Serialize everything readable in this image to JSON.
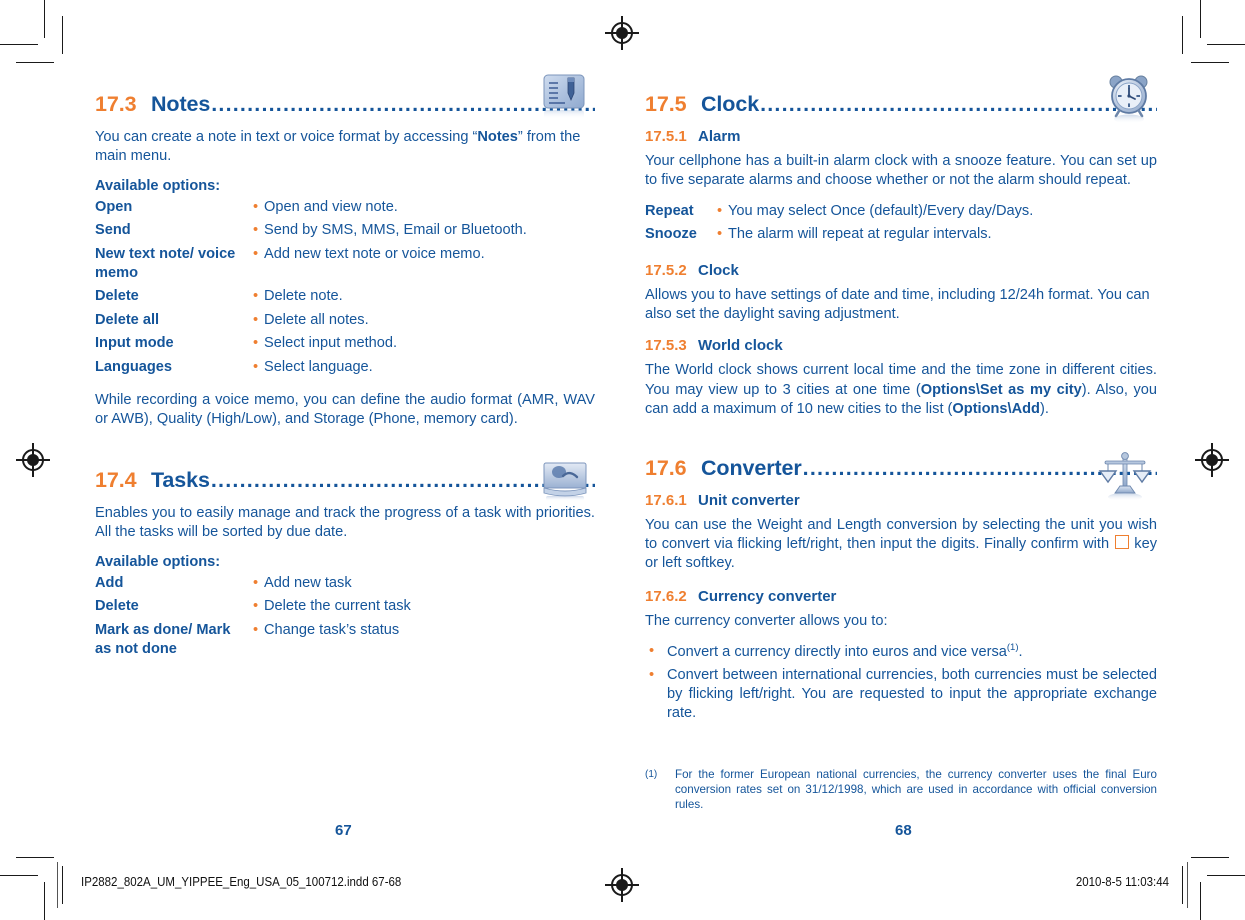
{
  "document": {
    "left_page_number": "67",
    "right_page_number": "68",
    "colors": {
      "heading_number": "#ef7f30",
      "heading_title": "#15559a",
      "body": "#15559a",
      "bullet": "#ef7f30"
    }
  },
  "left_column": {
    "section_notes": {
      "number": "17.3",
      "title": "Notes",
      "dots": "............................................................",
      "icon": "notepad-pen-icon",
      "intro_before_bold": "You can create a note in text or voice format by accessing “",
      "intro_bold": "Notes",
      "intro_after_bold": "” from the main menu.",
      "available_options_label": "Available options:",
      "options": [
        {
          "key": "Open",
          "value": "Open and view note."
        },
        {
          "key": "Send",
          "value": "Send by SMS, MMS, Email or Bluetooth."
        },
        {
          "key": "New text note/ voice memo",
          "value": "Add new text note or voice memo."
        },
        {
          "key": "Delete",
          "value": "Delete note."
        },
        {
          "key": "Delete all",
          "value": "Delete all notes."
        },
        {
          "key": "Input mode",
          "value": "Select input method."
        },
        {
          "key": "Languages",
          "value": "Select language."
        }
      ],
      "closing_paragraph": "While recording a voice memo, you can define the audio format (AMR, WAV or AWB), Quality (High/Low), and Storage (Phone, memory card)."
    },
    "section_tasks": {
      "number": "17.4",
      "title": "Tasks",
      "dots": "............................................................",
      "icon": "tasks-scroll-icon",
      "intro": "Enables you to easily manage and track the progress of a task with priorities. All the tasks will be sorted by due date.",
      "available_options_label": "Available options:",
      "options": [
        {
          "key": "Add",
          "value": "Add new task"
        },
        {
          "key": "Delete",
          "value": "Delete the current task"
        },
        {
          "key": "Mark as done/ Mark as not done",
          "value": "Change task’s status"
        }
      ]
    }
  },
  "right_column": {
    "section_clock": {
      "number": "17.5",
      "title": "Clock",
      "dots": "..............................................................",
      "icon": "alarm-clock-icon",
      "sub_alarm": {
        "number": "17.5.1",
        "title": "Alarm",
        "paragraph": "Your cellphone has a built-in alarm clock with a snooze feature. You can set up to five separate alarms and choose whether or not the alarm should repeat.",
        "options": [
          {
            "key": "Repeat",
            "value": "You may select Once (default)/Every day/Days."
          },
          {
            "key": "Snooze",
            "value": "The alarm will repeat at regular intervals."
          }
        ]
      },
      "sub_clock": {
        "number": "17.5.2",
        "title": "Clock",
        "paragraph": "Allows you to have settings of date and time, including 12/24h format. You can also set the daylight saving adjustment."
      },
      "sub_world_clock": {
        "number": "17.5.3",
        "title": "World clock",
        "para_a": "The World clock shows current local time and the time zone in different cities. You may view up to 3 cities at one time (",
        "para_bold_a": "Options\\Set as my city",
        "para_b": "). Also, you can add a maximum of 10 new cities to the list (",
        "para_bold_b": "Options\\Add",
        "para_c": ")."
      }
    },
    "section_converter": {
      "number": "17.6",
      "title": "Converter",
      "dots": "....................................................",
      "icon": "balance-scale-icon",
      "sub_unit": {
        "number": "17.6.1",
        "title": "Unit converter",
        "para_a": "You can use the Weight and Length conversion by selecting the unit you wish to convert via flicking left/right, then input the digits. Finally confirm with",
        "key_glyph": "softkey-box-icon",
        "para_b": "key or left softkey."
      },
      "sub_currency": {
        "number": "17.6.2",
        "title": "Currency converter",
        "intro": "The currency converter allows you to:",
        "bullets": [
          {
            "text": "Convert a currency directly into euros and vice versa",
            "footnote": "(1)",
            "tail": "."
          },
          {
            "text": "Convert between international currencies, both currencies must be selected by flicking left/right. You are requested to input the appropriate exchange rate.",
            "footnote": "",
            "tail": ""
          }
        ]
      }
    },
    "footnote": {
      "marker": "(1)",
      "text": "For the former European national currencies, the currency converter uses the final Euro conversion rates set on 31/12/1998, which are used in accordance with official conversion rules."
    }
  },
  "print_bar": {
    "filename": "IP2882_802A_UM_YIPPEE_Eng_USA_05_100712.indd   67-68",
    "datetime": "2010-8-5   11:03:44"
  }
}
